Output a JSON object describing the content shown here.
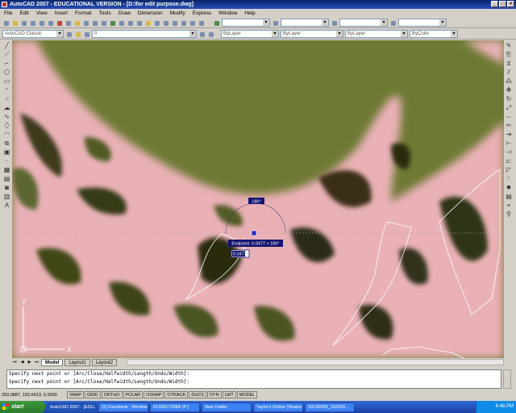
{
  "window": {
    "title": "AutoCAD 2007 - EDUCATIONAL VERSION - [D:\\for edit purpose.dwg]"
  },
  "menu": [
    "File",
    "Edit",
    "View",
    "Insert",
    "Format",
    "Tools",
    "Draw",
    "Dimension",
    "Modify",
    "Express",
    "Window",
    "Help"
  ],
  "toolbar2": {
    "workspace": "AutoCAD Classic",
    "layer": "0",
    "color": "ByLayer",
    "linetype": "ByLayer",
    "lineweight": "ByLayer",
    "plotstyle": "ByColor"
  },
  "canvas": {
    "angle_tooltip": "180°",
    "endpoint_tooltip": "Endpoint: 0.0477 < 180°",
    "dynamic_input_value": "0.0477",
    "ucs_x": "X",
    "ucs_y": "Y"
  },
  "tabs": [
    "Model",
    "Layout1",
    "Layout2"
  ],
  "command_lines": [
    "Specify next point or [Arc/Close/Halfwidth/Length/Undo/Width]:",
    "Specify next point or [Arc/Close/Halfwidth/Length/Undo/Width]:"
  ],
  "status": {
    "coords": "250.0887, 192.6413, 0.0000",
    "buttons": [
      "SNAP",
      "GRID",
      "ORTHO",
      "POLAR",
      "OSNAP",
      "OTRACK",
      "DUCS",
      "DYN",
      "LWT",
      "MODEL"
    ]
  },
  "taskbar": {
    "start": "start",
    "tasks": [
      "AutoCAD 2007 - [EDU...",
      "(2) Facebook - Windows...",
      "0133617208A (P:)",
      "New Folder",
      "Taylor's Online (Student)...",
      "20130609_102003..."
    ],
    "clock": "6:46 PM"
  }
}
